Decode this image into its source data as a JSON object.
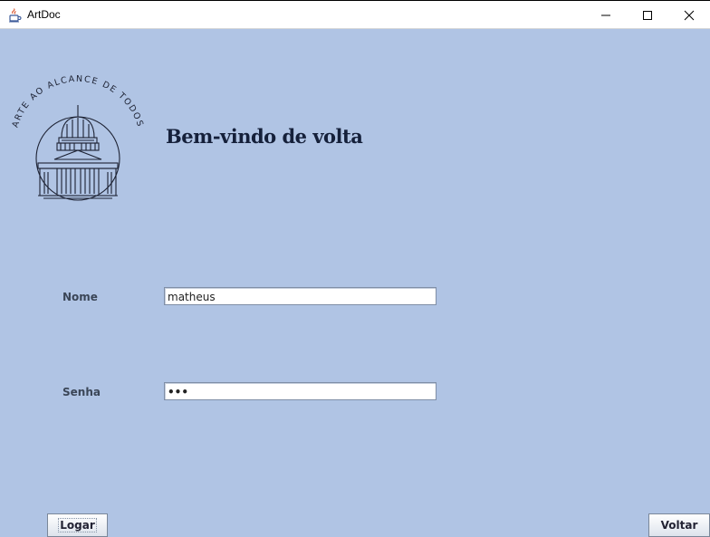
{
  "window": {
    "title": "ArtDoc",
    "icon": "java-app-icon"
  },
  "logo": {
    "tagline": "ARTE AO ALCANCE DE TODOS",
    "icon": "museum-dome-icon"
  },
  "welcome_heading": "Bem-vindo de volta",
  "form": {
    "nome_label": "Nome",
    "nome_value": "matheus",
    "senha_label": "Senha",
    "senha_value_masked": "•••"
  },
  "buttons": {
    "logar_label": "Logar",
    "voltar_label": "Voltar"
  },
  "colors": {
    "background": "#b0c4e4",
    "heading": "#15203a",
    "label": "#3b4657"
  }
}
